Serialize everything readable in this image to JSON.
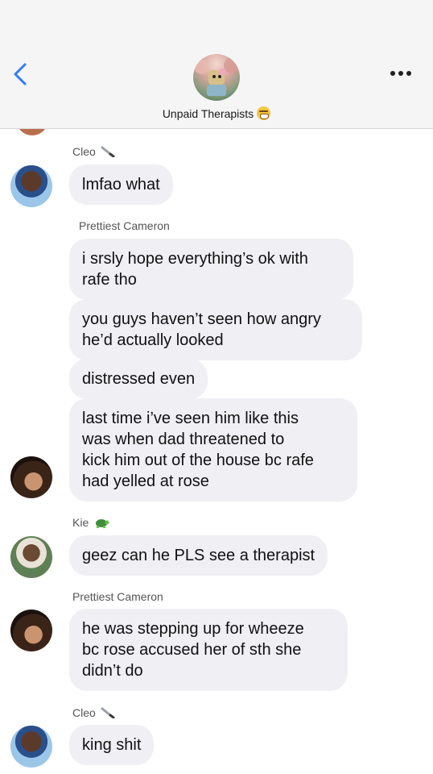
{
  "header": {
    "group_name": "Unpaid Therapists",
    "group_emoji": "grinning-face-emoji",
    "back_icon": "chevron-left-icon",
    "more_icon": "more-horizontal-icon",
    "accent_color": "#2f7cf6"
  },
  "messages": [
    {
      "sender": "Cleo",
      "sender_emoji": "knife-emoji",
      "texts": [
        "lmfao what"
      ]
    },
    {
      "sender": "Prettiest Cameron",
      "texts": [
        "i srsly hope everything’s ok with\nrafe tho",
        "you guys haven’t seen how angry\nhe’d actually looked",
        "distressed even",
        "last time i’ve seen him like this\nwas when dad threatened to\nkick him out of the house bc rafe\nhad yelled at rose"
      ]
    },
    {
      "sender": "Kie",
      "sender_emoji": "turtle-emoji",
      "texts": [
        "geez can he PLS see a therapist"
      ]
    },
    {
      "sender": "Prettiest Cameron",
      "texts": [
        "he was stepping up for wheeze\nbc rose accused her of sth she\ndidn’t do"
      ]
    },
    {
      "sender": "Cleo",
      "sender_emoji": "knife-emoji",
      "texts": [
        "king shit"
      ]
    }
  ],
  "colors": {
    "bubble_bg": "#efeff4",
    "header_bg": "#f5f5f5",
    "sender_text": "#555555"
  }
}
